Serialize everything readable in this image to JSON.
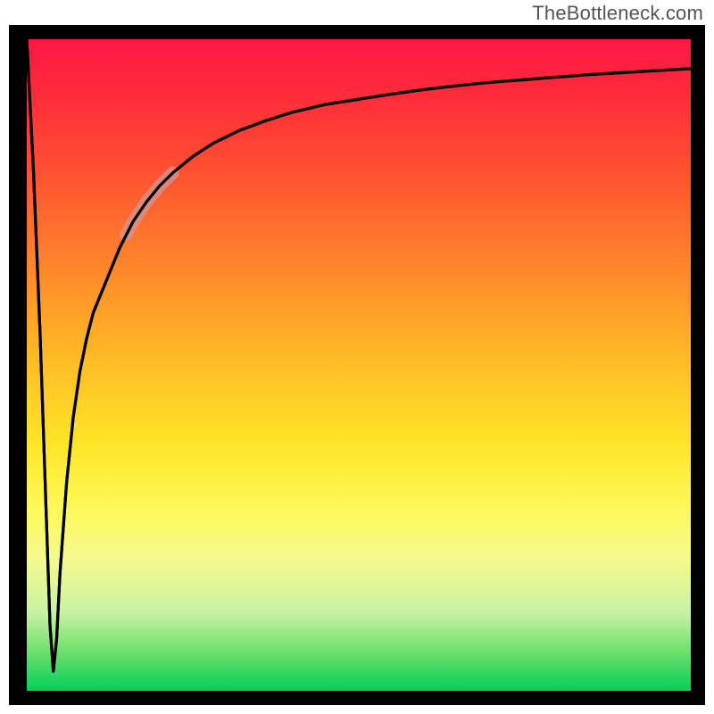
{
  "attribution": "TheBottleneck.com",
  "chart_data": {
    "type": "line",
    "title": "",
    "xlabel": "",
    "ylabel": "",
    "xlim": [
      0,
      100
    ],
    "ylim": [
      0,
      100
    ],
    "background_gradient": [
      "#ff1744",
      "#ff8a2a",
      "#ffe526",
      "#fff85a",
      "#00d15a"
    ],
    "annotation": "steep V-notch near x≈4 then rises toward an asymptote near y≈96",
    "notch_x": 4,
    "notch_y_bottom": 3,
    "asymptote_y": 95.5,
    "highlight_segment_x_range": [
      15,
      22
    ],
    "x": [
      0,
      1,
      2,
      3,
      3.5,
      4,
      4.5,
      5,
      6,
      7,
      8,
      9,
      10,
      12,
      14,
      16,
      18,
      20,
      22,
      25,
      28,
      32,
      36,
      40,
      45,
      50,
      55,
      60,
      65,
      70,
      75,
      80,
      85,
      90,
      95,
      100
    ],
    "y": [
      100,
      80,
      55,
      25,
      10,
      3,
      8,
      18,
      32,
      42,
      49,
      54,
      58,
      63,
      68,
      72,
      75,
      77.5,
      79.5,
      82,
      84,
      86,
      87.5,
      88.8,
      90,
      90.8,
      91.6,
      92.3,
      92.9,
      93.4,
      93.8,
      94.2,
      94.6,
      94.9,
      95.2,
      95.5
    ]
  }
}
